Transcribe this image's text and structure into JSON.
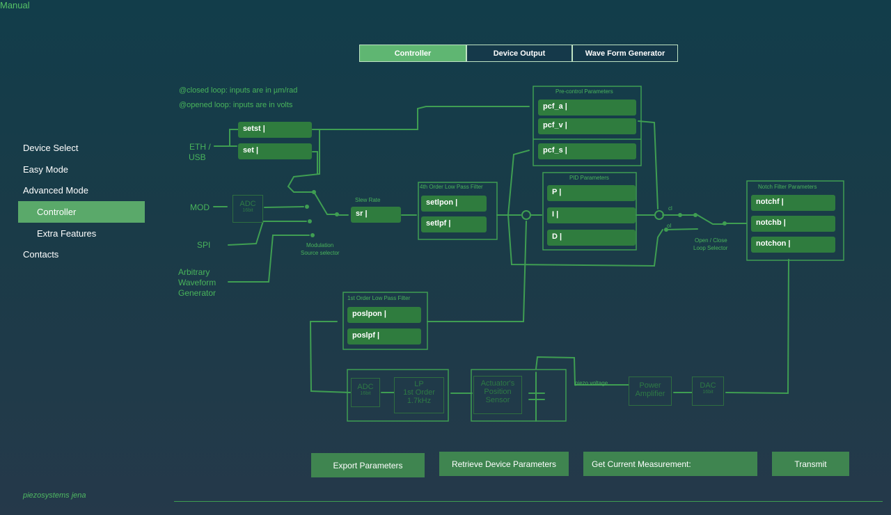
{
  "header": {
    "manual_link": "Manual"
  },
  "tabs": [
    {
      "label": "Controller",
      "active": true
    },
    {
      "label": "Device Output",
      "active": false
    },
    {
      "label": "Wave Form Generator",
      "active": false
    }
  ],
  "sidebar": {
    "items": [
      {
        "label": "Device Select"
      },
      {
        "label": "Easy Mode"
      },
      {
        "label": "Advanced Mode"
      },
      {
        "label": "Controller",
        "active": true
      },
      {
        "label": "Extra Features"
      },
      {
        "label": "Contacts"
      }
    ],
    "brand": "piezosystems jena"
  },
  "notes": {
    "closed_loop": "@closed loop:  inputs are in µm/rad",
    "opened_loop": "@opened loop:  inputs are in volts"
  },
  "inputs": {
    "eth": "ETH /",
    "usb": "USB",
    "mod": "MOD",
    "spi": "SPI",
    "awg_line1": "Arbitrary",
    "awg_line2": "Waveform",
    "awg_line3": "Generator"
  },
  "diagram": {
    "adc_top": "ADC",
    "adc_top_bits": "16bit",
    "mod_selector_1": "Modulation",
    "mod_selector_2": "Source selector",
    "slew_rate": "Slew Rate",
    "lpf4_title": "4th Order Low Pass Filter",
    "precontrol_title": "Pre-control Parameters",
    "pid_title": "PID Parameters",
    "notch_title": "Notch Filter Parameters",
    "lpf1_title": "1st Order Low Pass Filter",
    "cl": "cl",
    "ol": "ol",
    "loop_sel_1": "Open / Close",
    "loop_sel_2": "Loop Selector",
    "piezo_voltage": "piezo voltage",
    "power_amp_1": "Power",
    "power_amp_2": "Amplifier",
    "dac": "DAC",
    "dac_bits": "16bit",
    "sensor_1": "Actuator's",
    "sensor_2": "Position",
    "sensor_3": "Sensor",
    "lp_1": "LP",
    "lp_2": "1st Order",
    "lp_3": "1.7kHz",
    "adc_bottom": "ADC",
    "adc_bottom_bits": "16bit"
  },
  "fields": {
    "setst": "setst |",
    "set": "set |",
    "sr": "sr |",
    "setlpon": "setlpon |",
    "setlpf": "setlpf |",
    "pcf_a": "pcf_a |",
    "pcf_v": "pcf_v |",
    "pcf_s": "pcf_s |",
    "p": "P |",
    "i": "I |",
    "d": "D |",
    "notchf": "notchf |",
    "notchb": "notchb |",
    "notchon": "notchon |",
    "poslpon": "poslpon |",
    "poslpf": "poslpf |"
  },
  "buttons": {
    "export": "Export Parameters",
    "retrieve": "Retrieve Device Parameters",
    "measure": "Get Current Measurement:",
    "transmit": "Transmit"
  },
  "colors": {
    "accent": "#5fb672",
    "line": "#3f9e52",
    "field": "#2f7c3e"
  }
}
